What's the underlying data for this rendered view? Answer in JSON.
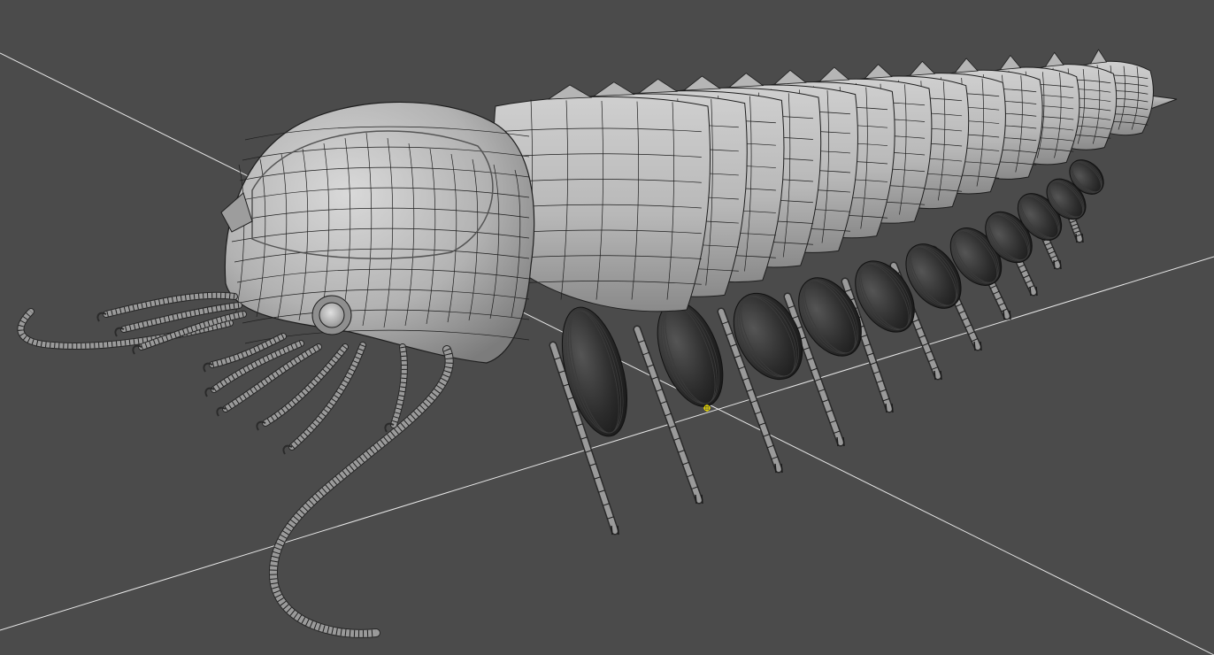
{
  "viewport": {
    "background": "#4b4b4b",
    "grid_axis_color": "#e8e8e8",
    "model_fill": "#bdbdbd",
    "model_shade": "#7a7a7a",
    "wire_color": "#1e1e1e",
    "pivot_color": "#e8d800",
    "model_name": "trilobite-wireframe-model",
    "segment_count": 13,
    "leg_count": 11
  }
}
